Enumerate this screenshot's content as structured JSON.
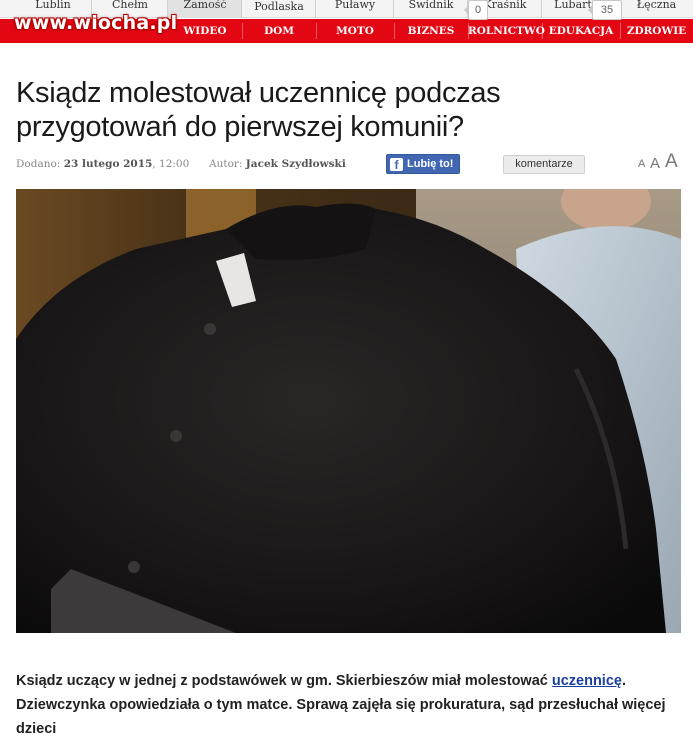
{
  "watermark": "www.wiocha.pl",
  "city_nav": [
    "Lublin",
    "Chełm",
    "Zamość",
    "Biała Podlaska",
    "Puławy",
    "Świdnik",
    "Kraśnik",
    "Lubartów",
    "Łęczna"
  ],
  "category_nav": [
    "WIDEO",
    "DOM",
    "MOTO",
    "BIZNES",
    "ROLNICTWO",
    "EDUKACJA",
    "ZDROWIE"
  ],
  "article": {
    "title": "Ksiądz molestował uczennicę podczas przygotowań do pierwszej komunii?",
    "added_label": "Dodano:",
    "added_date": "23 lutego 2015",
    "added_time": ", 12:00",
    "author_label": "Autor:",
    "author": "Jacek Szydłowski",
    "like_label": "Lubię to!",
    "like_count": "0",
    "comments_label": "komentarze",
    "comments_count": "35",
    "font_sizes": [
      "A",
      "A",
      "A"
    ],
    "lead_part1": "Ksiądz uczący w jednej z podstawówek w gm. Skierbieszów miał molestować ",
    "lead_link": "uczennicę",
    "lead_part2": ". Dziewczynka opowiedziała o tym matce. Sprawą zajęła się prokuratura, sąd przesłuchał więcej dzieci"
  },
  "colors": {
    "category_bar": "#e30613",
    "facebook": "#4267b2",
    "link": "#1a3fa0"
  }
}
